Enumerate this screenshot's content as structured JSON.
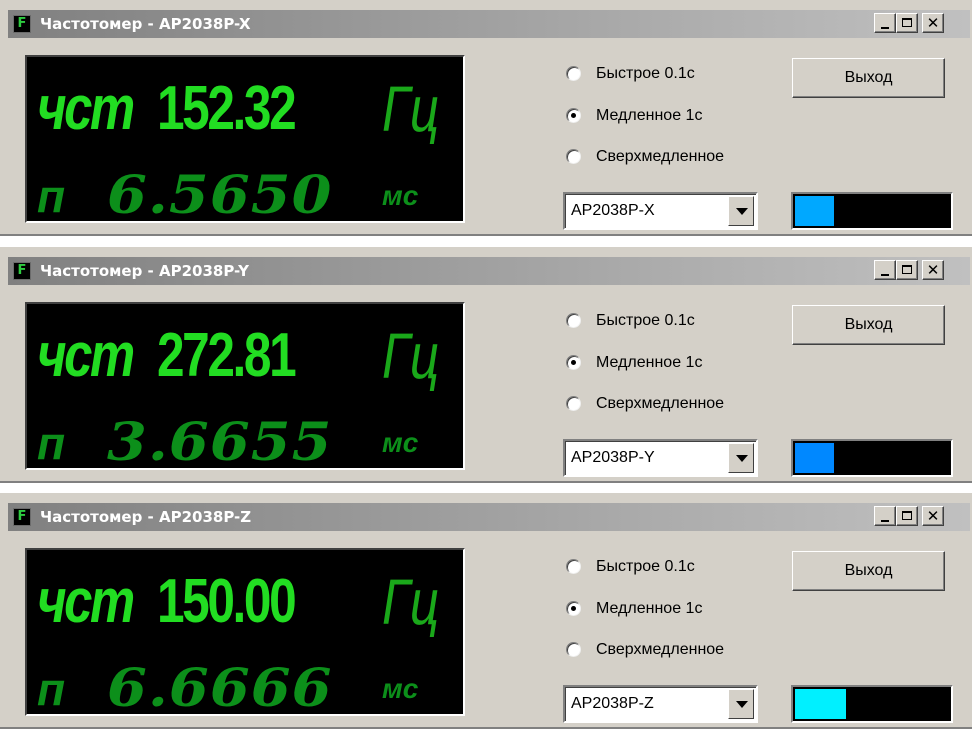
{
  "windows": [
    {
      "title": "Частотомер - AP2038P-X",
      "app_icon": "F",
      "frequency_prefix": "чст",
      "frequency_value": "152.32",
      "frequency_unit": "Гц",
      "period_prefix": "п",
      "period_value": "6.5650",
      "period_unit": "мс",
      "modes": [
        "Быстрое 0.1с",
        "Медленное 1с",
        "Сверхмедленное"
      ],
      "selected_mode": 1,
      "exit_label": "Выход",
      "device_select": "AP2038P-X",
      "level_color": "#00a8ff",
      "level_fraction": 0.25
    },
    {
      "title": "Частотомер - AP2038P-Y",
      "app_icon": "F",
      "frequency_prefix": "чст",
      "frequency_value": "272.81",
      "frequency_unit": "Гц",
      "period_prefix": "п",
      "period_value": "3.6655",
      "period_unit": "мс",
      "modes": [
        "Быстрое 0.1с",
        "Медленное 1с",
        "Сверхмедленное"
      ],
      "selected_mode": 1,
      "exit_label": "Выход",
      "device_select": "AP2038P-Y",
      "level_color": "#0088ff",
      "level_fraction": 0.25
    },
    {
      "title": "Частотомер - AP2038P-Z",
      "app_icon": "F",
      "frequency_prefix": "чст",
      "frequency_value": "150.00",
      "frequency_unit": "Гц",
      "period_prefix": "п",
      "period_value": "6.6666",
      "period_unit": "мс",
      "modes": [
        "Быстрое 0.1с",
        "Медленное 1с",
        "Сверхмедленное"
      ],
      "selected_mode": 1,
      "exit_label": "Выход",
      "device_select": "AP2038P-Z",
      "level_color": "#00f0ff",
      "level_fraction": 0.33
    }
  ]
}
